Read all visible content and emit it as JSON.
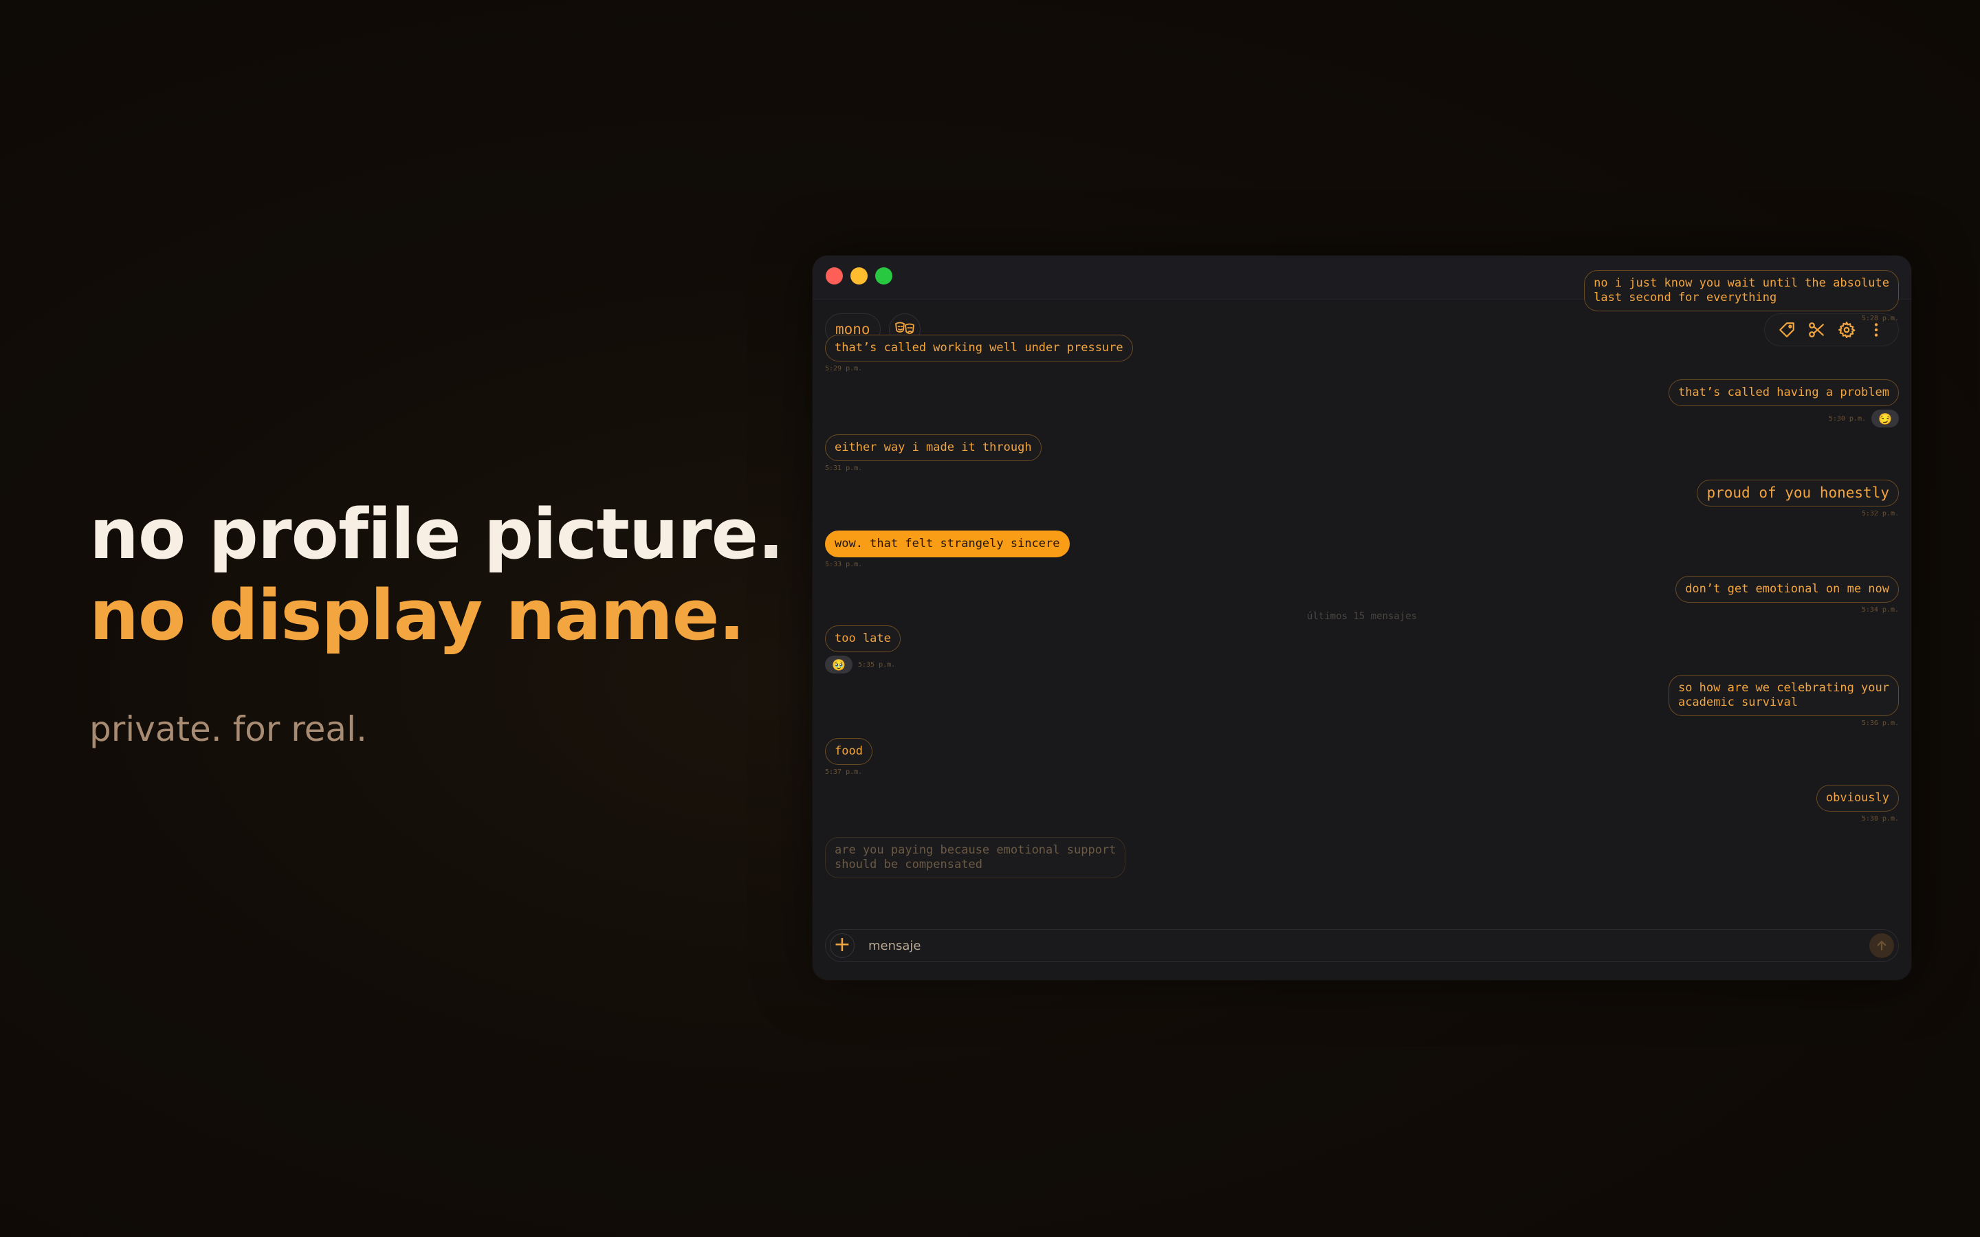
{
  "hero": {
    "line1": "no profile picture.",
    "line2": "no display name.",
    "sub": "private. for real."
  },
  "colors": {
    "accent": "#f3a53f",
    "filled_bubble": "#f99d16",
    "background": "#0d0905"
  },
  "window": {
    "username": "mono",
    "toolbar_icons": [
      "tag-icon",
      "scissors-icon",
      "gear-icon",
      "more-vertical-icon"
    ],
    "divider": "últimos 15 mensajes",
    "composer_placeholder": "mensaje",
    "messages": [
      {
        "side": "out",
        "text": "no i just know you wait until the absolute\nlast second for everything",
        "time": "5:28 p.m."
      },
      {
        "side": "in",
        "text": "that’s called working well under pressure",
        "time": "5:29 p.m."
      },
      {
        "side": "out",
        "text": "that’s called having a problem",
        "time": "5:30 p.m.",
        "reaction": "😏"
      },
      {
        "side": "in",
        "text": "either way i made it through",
        "time": "5:31 p.m."
      },
      {
        "side": "out",
        "text": "proud of you honestly",
        "time": "5:32 p.m."
      },
      {
        "side": "in",
        "text": "wow. that felt strangely sincere",
        "time": "5:33 p.m."
      },
      {
        "side": "out",
        "text": "don’t get emotional on me now",
        "time": "5:34 p.m."
      },
      {
        "side": "in",
        "text": "too late",
        "time": "5:35 p.m.",
        "reaction": "🥹"
      },
      {
        "side": "out",
        "text": "so how are we celebrating your\nacademic survival",
        "time": "5:36 p.m."
      },
      {
        "side": "in",
        "text": "food",
        "time": "5:37 p.m."
      },
      {
        "side": "out",
        "text": "obviously",
        "time": "5:38 p.m."
      },
      {
        "side": "in",
        "text": "are you paying because emotional support\nshould be compensated"
      }
    ]
  }
}
